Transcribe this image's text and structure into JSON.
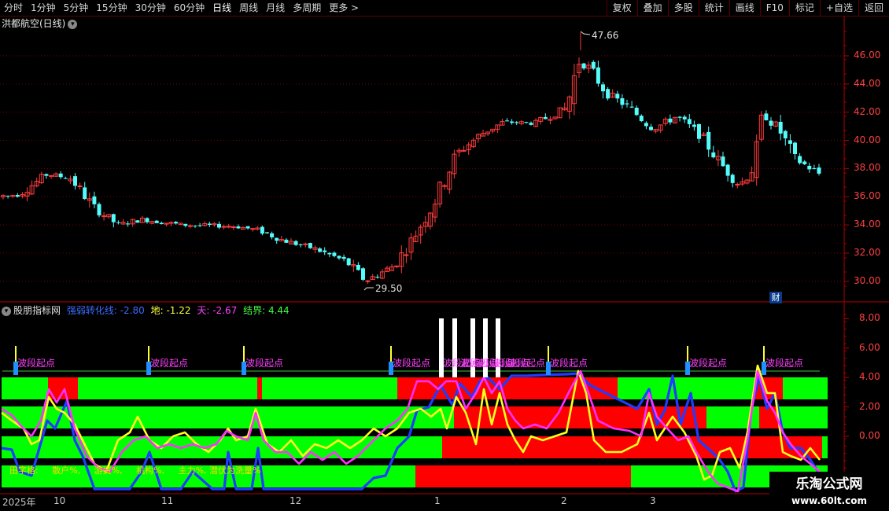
{
  "toolbar": {
    "left": [
      "分时",
      "1分钟",
      "5分钟",
      "15分钟",
      "30分钟",
      "60分钟",
      "日线",
      "周线",
      "月线",
      "多周期",
      "更多 >"
    ],
    "right": [
      "复权",
      "叠加",
      "多股",
      "统计",
      "画线",
      "F10",
      "标记",
      "+自选",
      "返回"
    ]
  },
  "stock": {
    "title": "洪都航空(日线)",
    "high_label": "47.66",
    "low_label": "29.50",
    "cai_badge": "财"
  },
  "price_axis": [
    "46.00",
    "44.00",
    "42.00",
    "40.00",
    "38.00",
    "36.00",
    "34.00",
    "32.00",
    "30.00"
  ],
  "indicator": {
    "name": "股朋指标网",
    "fields": [
      {
        "label": "强弱转化线: -2.80",
        "color": "#3a6cff"
      },
      {
        "label": "地: -1.22",
        "color": "#ffff40"
      },
      {
        "label": "天: -2.67",
        "color": "#ff40ff"
      },
      {
        "label": "结界: 4.44",
        "color": "#40ff40"
      }
    ],
    "axis": [
      "8.00",
      "6.00",
      "4.00",
      "2.00",
      "0.00"
    ],
    "signal_label": "波段起点",
    "legend": [
      {
        "text": "田字格:",
        "color": "#ffd700"
      },
      {
        "text": "散户%,",
        "color": "#ffd700"
      },
      {
        "text": "游资%,",
        "color": "#ffd700"
      },
      {
        "text": "机构%,",
        "color": "#ffd700"
      },
      {
        "text": "主力%,",
        "color": "#ffd700"
      },
      {
        "text": "潜伏为洗量%",
        "color": "#ffd700"
      }
    ]
  },
  "dates": [
    "2025年",
    "10",
    "11",
    "12",
    "1",
    "2",
    "3"
  ],
  "watermark": {
    "title": "乐淘公式网",
    "url": "www.60lt.com"
  },
  "colors": {
    "up": "#ff3c3c",
    "down": "#54fcfc",
    "grid": "#7a0000",
    "green": "#00ff00",
    "red": "#ff0000"
  }
}
